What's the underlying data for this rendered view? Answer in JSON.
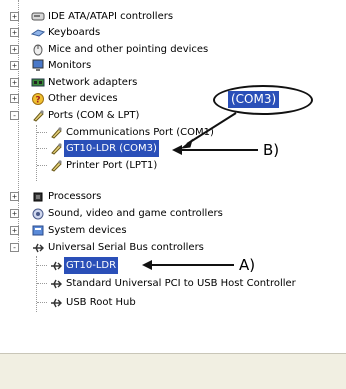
{
  "tree": {
    "items": [
      {
        "label": "IDE ATA/ATAPI controllers",
        "expander": "+",
        "icon": "disk-controller-icon"
      },
      {
        "label": "Keyboards",
        "expander": "+",
        "icon": "keyboard-icon"
      },
      {
        "label": "Mice and other pointing devices",
        "expander": "+",
        "icon": "mouse-icon"
      },
      {
        "label": "Monitors",
        "expander": "+",
        "icon": "monitor-icon"
      },
      {
        "label": "Network adapters",
        "expander": "+",
        "icon": "network-card-icon"
      },
      {
        "label": "Other devices",
        "expander": "+",
        "icon": "unknown-device-icon"
      },
      {
        "label": "Ports (COM & LPT)",
        "expander": "-",
        "icon": "port-icon"
      },
      {
        "label": "Communications Port (COM1)",
        "icon": "port-icon"
      },
      {
        "label": "GT10-LDR (COM3)",
        "icon": "port-icon",
        "selected": true
      },
      {
        "label": "Printer Port (LPT1)",
        "icon": "port-icon"
      },
      {
        "label": "Processors",
        "expander": "+",
        "icon": "processor-icon"
      },
      {
        "label": "Sound, video and game controllers",
        "expander": "+",
        "icon": "sound-icon"
      },
      {
        "label": "System devices",
        "expander": "+",
        "icon": "system-icon"
      },
      {
        "label": "Universal Serial Bus controllers",
        "expander": "-",
        "icon": "usb-icon"
      },
      {
        "label": "GT10-LDR",
        "icon": "usb-icon",
        "selected": true
      },
      {
        "label": "Standard Universal PCI to USB Host Controller",
        "icon": "usb-icon"
      },
      {
        "label": "USB Root Hub",
        "icon": "usb-icon"
      }
    ]
  },
  "annotations": {
    "callout": "(COM3)",
    "label_b": "B)",
    "label_a": "A)"
  },
  "colors": {
    "selection": "#2a4fb8",
    "statusbar": "#f1efe2"
  }
}
